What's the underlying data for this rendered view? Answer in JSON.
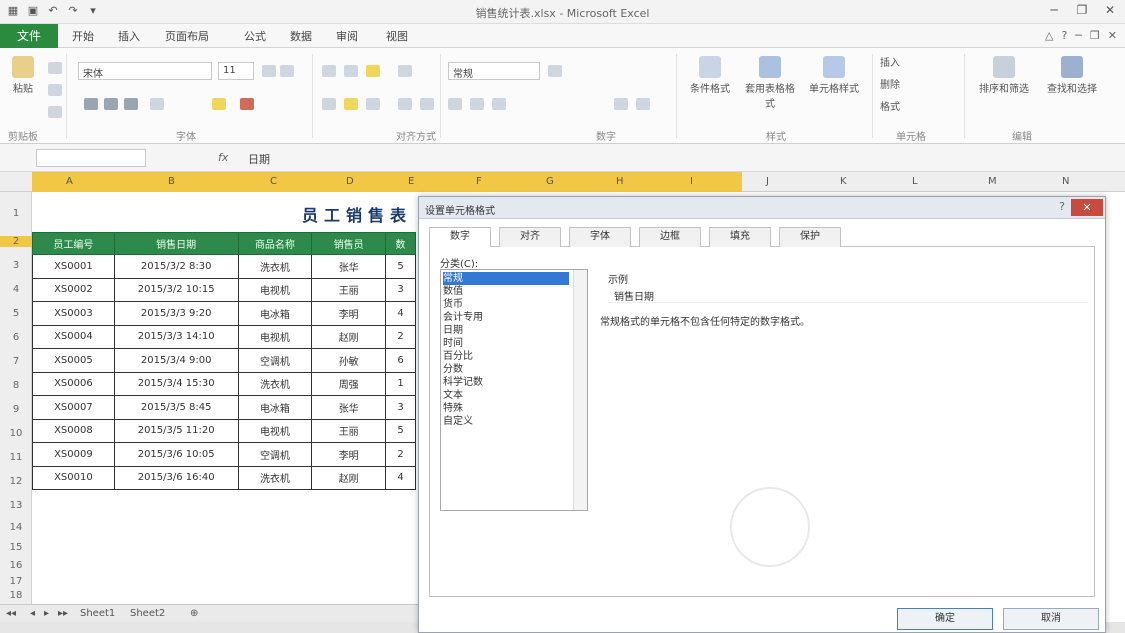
{
  "window": {
    "title": "销售统计表.xlsx - Microsoft Excel"
  },
  "ribbon": {
    "file_tab": "文件",
    "tabs": [
      "开始",
      "插入",
      "页面布局",
      "公式",
      "数据",
      "审阅",
      "视图"
    ],
    "font_name": "宋体",
    "font_size": "11",
    "number_format": "常规",
    "buttons": [
      "粘贴",
      "条件格式",
      "套用表格格式",
      "单元格样式",
      "插入",
      "删除",
      "格式",
      "排序和筛选",
      "查找和选择"
    ],
    "groups": [
      "剪贴板",
      "字体",
      "对齐方式",
      "数字",
      "样式",
      "单元格",
      "编辑"
    ]
  },
  "formula_bar": {
    "name_box": "",
    "fx": "fx",
    "value": "日期"
  },
  "columns": [
    "A",
    "B",
    "C",
    "D",
    "E",
    "F",
    "G",
    "H",
    "I",
    "J",
    "K",
    "L",
    "M",
    "N"
  ],
  "rows": [
    "1",
    "2",
    "3",
    "4",
    "5",
    "6",
    "7",
    "8",
    "9",
    "10",
    "11",
    "12",
    "13",
    "14",
    "15",
    "16",
    "17",
    "18"
  ],
  "sheet": {
    "title": "员工销售表",
    "headers": [
      "员工编号",
      "销售日期",
      "商品名称",
      "销售员",
      "数"
    ],
    "rows": [
      [
        "XS0001",
        "2015/3/2 8:30",
        "洗衣机",
        "张华",
        "5"
      ],
      [
        "XS0002",
        "2015/3/2 10:15",
        "电视机",
        "王丽",
        "3"
      ],
      [
        "XS0003",
        "2015/3/3 9:20",
        "电冰箱",
        "李明",
        "4"
      ],
      [
        "XS0004",
        "2015/3/3 14:10",
        "电视机",
        "赵刚",
        "2"
      ],
      [
        "XS0005",
        "2015/3/4 9:00",
        "空调机",
        "孙敏",
        "6"
      ],
      [
        "XS0006",
        "2015/3/4 15:30",
        "洗衣机",
        "周强",
        "1"
      ],
      [
        "XS0007",
        "2015/3/5 8:45",
        "电冰箱",
        "张华",
        "3"
      ],
      [
        "XS0008",
        "2015/3/5 11:20",
        "电视机",
        "王丽",
        "5"
      ],
      [
        "XS0009",
        "2015/3/6 10:05",
        "空调机",
        "李明",
        "2"
      ],
      [
        "XS0010",
        "2015/3/6 16:40",
        "洗衣机",
        "赵刚",
        "4"
      ]
    ]
  },
  "sheet_tabs": [
    "Sheet1",
    "Sheet2"
  ],
  "dialog": {
    "title": "设置单元格格式",
    "help": "?",
    "close": "✕",
    "tabs": [
      "数字",
      "对齐",
      "字体",
      "边框",
      "填充",
      "保护"
    ],
    "category_label": "分类(C):",
    "categories": [
      "常规",
      "数值",
      "货币",
      "会计专用",
      "日期",
      "时间",
      "百分比",
      "分数",
      "科学记数",
      "文本",
      "特殊",
      "自定义"
    ],
    "selected_category": 0,
    "sample_label": "示例",
    "sample_value": "销售日期",
    "description": "常规格式的单元格不包含任何特定的数字格式。",
    "ok_button": "确定",
    "cancel_button": "取消"
  },
  "colors": {
    "file_tab": "#2a8a3e",
    "table_header": "#2d8a4c",
    "column_selection": "#f2c744",
    "category_selected": "#3478d6",
    "dialog_close": "#c94a3e"
  }
}
